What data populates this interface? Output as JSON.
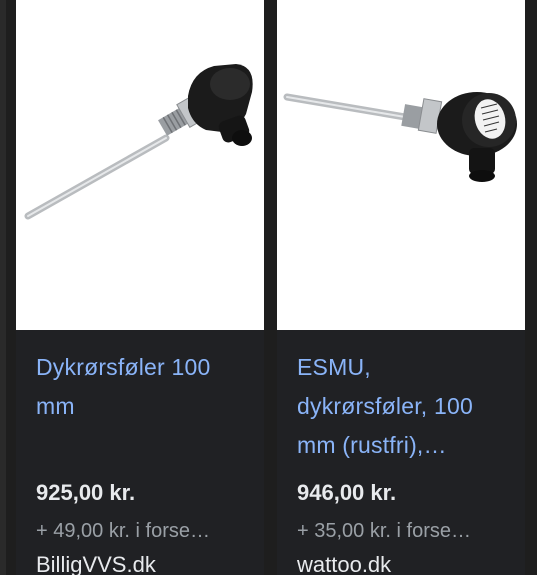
{
  "products": [
    {
      "title_line1": "Dykrørsføler 100",
      "title_line2": "mm",
      "title_line3": "",
      "price": "925,00 kr.",
      "shipping": "+ 49,00 kr. i forse…",
      "seller": "BilligVVS.dk",
      "image_icon": "thermocouple-probe-image"
    },
    {
      "title_line1": "ESMU,",
      "title_line2": "dykrørsføler, 100",
      "title_line3": "mm (rustfri),…",
      "price": "946,00 kr.",
      "shipping": "+ 35,00 kr. i forse…",
      "seller": "wattoo.dk",
      "image_icon": "thermocouple-probe-image"
    }
  ],
  "colors": {
    "background": "#1e1e1e",
    "card_info": "#202124",
    "title_link": "#8ab4f8",
    "price": "#e8eaed",
    "secondary": "#9aa0a6"
  }
}
